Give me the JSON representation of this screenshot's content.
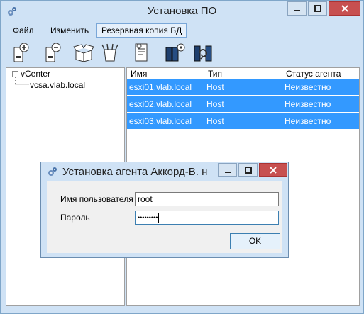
{
  "window": {
    "title": "Установка ПО"
  },
  "menu": {
    "file": "Файл",
    "edit": "Изменить",
    "backup": "Резервная копия БД"
  },
  "tree": {
    "root": "vCenter",
    "child": "vcsa.vlab.local"
  },
  "grid": {
    "columns": [
      "Имя",
      "Тип",
      "Статус агента"
    ],
    "rows": [
      [
        "esxi01.vlab.local",
        "Host",
        "Неизвестно"
      ],
      [
        "esxi02.vlab.local",
        "Host",
        "Неизвестно"
      ],
      [
        "esxi03.vlab.local",
        "Host",
        "Неизвестно"
      ]
    ]
  },
  "dialog": {
    "title": "Установка агента Аккорд-В. н",
    "username_label": "Имя пользователя",
    "username_value": "root",
    "password_label": "Пароль",
    "password_value": "•••••••••",
    "ok_label": "OK"
  },
  "colors": {
    "selection": "#3399ff",
    "chrome": "#cfe2f5",
    "close_button": "#c75050"
  }
}
